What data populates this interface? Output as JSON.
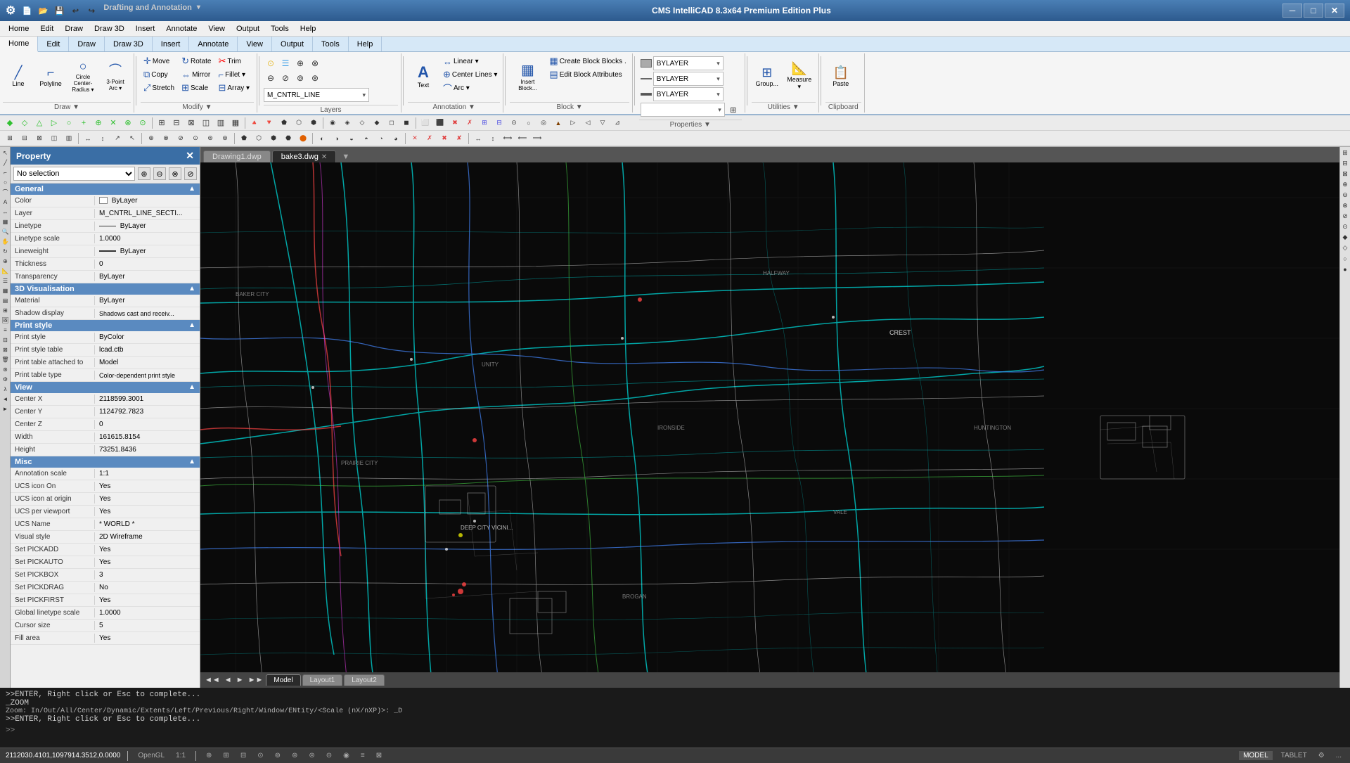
{
  "app": {
    "title": "CMS IntelliCAD 8.3x64 Premium Edition Plus",
    "icon": "⚙"
  },
  "titlebar": {
    "controls": {
      "minimize": "─",
      "maximize": "□",
      "close": "✕"
    }
  },
  "menubar": {
    "items": [
      "Home",
      "Edit",
      "Draw",
      "Draw 3D",
      "Insert",
      "Annotate",
      "View",
      "Output",
      "Tools",
      "Help"
    ]
  },
  "ribbon": {
    "tabs": [
      "Home",
      "Edit",
      "Draw",
      "Draw 3D",
      "Insert",
      "Annotate",
      "View",
      "Output",
      "Tools",
      "Help"
    ],
    "active_tab": "Home",
    "groups": {
      "draw": {
        "label": "Draw ▼",
        "items": [
          {
            "label": "Line",
            "icon": "╱"
          },
          {
            "label": "Polyline",
            "icon": "⌐"
          },
          {
            "label": "Circle\nCenter-Radius",
            "icon": "○"
          },
          {
            "label": "3-Point\nArc",
            "icon": "⌒"
          }
        ]
      },
      "modify": {
        "label": "Modify ▼",
        "items": [
          {
            "label": "Move",
            "icon": "✛"
          },
          {
            "label": "Rotate",
            "icon": "↻"
          },
          {
            "label": "Trim",
            "icon": "✂"
          },
          {
            "label": "Copy",
            "icon": "⧉"
          },
          {
            "label": "Mirror",
            "icon": "⇔"
          },
          {
            "label": "Fillet",
            "icon": "⌐"
          },
          {
            "label": "Stretch",
            "icon": "⤢"
          },
          {
            "label": "Scale",
            "icon": "⊞"
          },
          {
            "label": "Array",
            "icon": "⊟"
          }
        ]
      },
      "layers": {
        "label": "Layers",
        "dropdown_value": "M_CNTRL_LINE"
      },
      "annotation": {
        "label": "Annotation ▼",
        "items": [
          {
            "label": "Linear",
            "icon": "↔"
          },
          {
            "label": "Center Lines",
            "icon": "⊕"
          },
          {
            "label": "Arc",
            "icon": "⌒"
          },
          {
            "label": "Text",
            "icon": "A"
          }
        ]
      },
      "block": {
        "label": "Block ▼",
        "items": [
          {
            "label": "Create Block",
            "icon": "▦"
          },
          {
            "label": "Blocks...",
            "icon": "▦"
          },
          {
            "label": "Edit Block Attributes",
            "icon": "▤"
          },
          {
            "label": "Insert Block...",
            "icon": "▦"
          }
        ]
      },
      "properties": {
        "label": "Properties ▼",
        "dropdowns": [
          "BYLAYER",
          "BYLAYER",
          "BYLAYER"
        ]
      },
      "utilities": {
        "label": "Utilities ▼",
        "items": [
          {
            "label": "Group...",
            "icon": "⊞"
          },
          {
            "label": "Measure",
            "icon": "📐"
          }
        ]
      },
      "clipboard": {
        "label": "Clipboard",
        "items": [
          {
            "label": "Paste",
            "icon": "📋"
          }
        ]
      }
    }
  },
  "property_panel": {
    "title": "Property",
    "selection": "No selection",
    "sections": {
      "general": {
        "label": "General",
        "rows": [
          {
            "label": "Color",
            "value": "ByLayer",
            "type": "color"
          },
          {
            "label": "Layer",
            "value": "M_CNTRL_LINE_SECTI..."
          },
          {
            "label": "Linetype",
            "value": "ByLayer",
            "type": "linetype"
          },
          {
            "label": "Linetype scale",
            "value": "1.0000"
          },
          {
            "label": "Lineweight",
            "value": "ByLayer",
            "type": "linetype"
          },
          {
            "label": "Thickness",
            "value": "0"
          },
          {
            "label": "Transparency",
            "value": "ByLayer"
          }
        ]
      },
      "visualisation_3d": {
        "label": "3D Visualisation",
        "rows": [
          {
            "label": "Material",
            "value": "ByLayer"
          },
          {
            "label": "Shadow display",
            "value": "Shadows cast and receiv..."
          }
        ]
      },
      "print_style": {
        "label": "Print style",
        "rows": [
          {
            "label": "Print style",
            "value": "ByColor"
          },
          {
            "label": "Print style table",
            "value": "lcad.ctb"
          },
          {
            "label": "Print table attached to",
            "value": "Model"
          },
          {
            "label": "Print table type",
            "value": "Color-dependent print style"
          }
        ]
      },
      "view": {
        "label": "View",
        "rows": [
          {
            "label": "Center X",
            "value": "2118599.3001"
          },
          {
            "label": "Center Y",
            "value": "1124792.7823"
          },
          {
            "label": "Center Z",
            "value": "0"
          },
          {
            "label": "Width",
            "value": "161615.8154"
          },
          {
            "label": "Height",
            "value": "73251.8436"
          }
        ]
      },
      "misc": {
        "label": "Misc",
        "rows": [
          {
            "label": "Annotation scale",
            "value": "1:1"
          },
          {
            "label": "UCS icon On",
            "value": "Yes"
          },
          {
            "label": "UCS icon at origin",
            "value": "Yes"
          },
          {
            "label": "UCS per viewport",
            "value": "Yes"
          },
          {
            "label": "UCS Name",
            "value": "* WORLD *"
          },
          {
            "label": "Visual style",
            "value": "2D Wireframe"
          },
          {
            "label": "Set PICKADD",
            "value": "Yes"
          },
          {
            "label": "Set PICKAUTO",
            "value": "Yes"
          },
          {
            "label": "Set PICKBOX",
            "value": "3"
          },
          {
            "label": "Set PICKDRAG",
            "value": "No"
          },
          {
            "label": "Set PICKFIRST",
            "value": "Yes"
          },
          {
            "label": "Global linetype scale",
            "value": "1.0000"
          },
          {
            "label": "Cursor size",
            "value": "5"
          },
          {
            "label": "Fill area",
            "value": "Yes"
          }
        ]
      }
    }
  },
  "drawing_tabs": [
    {
      "label": "Drawing1.dwp",
      "active": false,
      "closable": false
    },
    {
      "label": "bake3.dwg",
      "active": true,
      "closable": true
    }
  ],
  "model_tabs": {
    "nav_prev": "◄",
    "nav_first": "◄◄",
    "nav_next": "►",
    "nav_last": "►►",
    "tabs": [
      {
        "label": "Model",
        "active": true
      },
      {
        "label": "Layout1",
        "active": false
      },
      {
        "label": "Layout2",
        "active": false
      }
    ]
  },
  "command_lines": [
    ">>ENTER, Right click or Esc to complete...",
    "  _ZOOM",
    "Zoom:  In/Out/All/Center/Dynamic/Extents/Left/Previous/Right/Window/ENtity/<Scale (nX/nXP)>: _D",
    ">>ENTER, Right click or Esc to complete..."
  ],
  "statusbar": {
    "coordinates": "2112030.4101,1097914.3512,0.0000",
    "renderer": "OpenGL",
    "scale": "1:1",
    "items": [
      "⊞",
      "⊟",
      "⊕",
      "⊗",
      "⊘",
      "⊙",
      "⊚",
      "⊛",
      "⊜",
      "⊝",
      "MODEL",
      "TABLET",
      "⚙",
      "..."
    ]
  }
}
